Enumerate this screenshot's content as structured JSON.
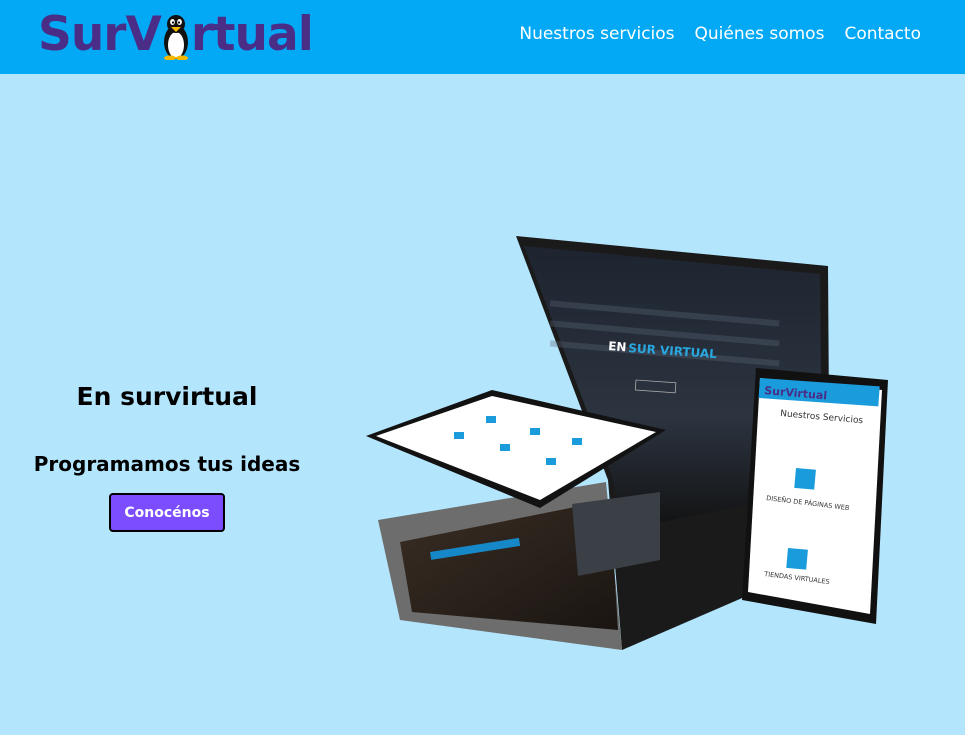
{
  "header": {
    "logo_left": "SurV",
    "logo_right": "rtual",
    "nav": [
      {
        "label": "Nuestros servicios"
      },
      {
        "label": "Quiénes somos"
      },
      {
        "label": "Contacto"
      }
    ]
  },
  "hero": {
    "title": "En survirtual",
    "subtitle": "Programamos tus ideas",
    "button": "Conocénos",
    "mockup": {
      "laptop_heading_1": "EN",
      "laptop_heading_2": "SUR VIRTUAL",
      "phone_logo": "SurVirtual",
      "phone_title": "Nuestros Servicios",
      "phone_service_1": "DISEÑO DE PÁGINAS WEB",
      "phone_service_2": "TIENDAS VIRTUALES"
    }
  },
  "colors": {
    "navbar": "#03a9f4",
    "background": "#b3e5fc",
    "logo": "#4a2d86",
    "button": "#7c4dff"
  }
}
